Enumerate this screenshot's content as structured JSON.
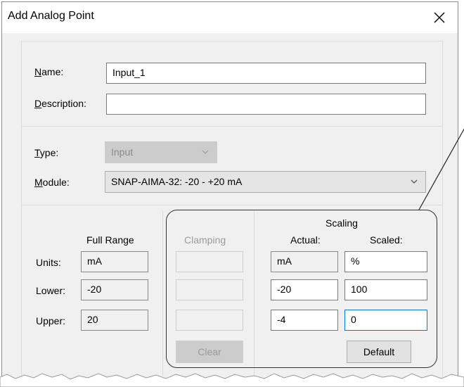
{
  "dialog": {
    "title": "Add Analog Point",
    "close_icon": "close-icon"
  },
  "general": {
    "name": {
      "label_accel": "N",
      "label_rest": "ame:",
      "value": "Input_1"
    },
    "description": {
      "label_accel": "D",
      "label_rest": "escription:",
      "value": ""
    }
  },
  "point": {
    "type": {
      "label_accel": "T",
      "label_rest": "ype:",
      "value": "Input"
    },
    "module": {
      "label_accel": "M",
      "label_rest": "odule:",
      "value": "SNAP-AIMA-32: -20 - +20 mA"
    }
  },
  "ranges": {
    "full_range_heading": "Full Range",
    "clamping_heading": "Clamping",
    "scaling_heading": "Scaling",
    "actual_heading": "Actual:",
    "scaled_heading": "Scaled:",
    "rows": [
      {
        "label": "Units:",
        "full": "mA",
        "actual": "mA",
        "scaled": "%"
      },
      {
        "label": "Lower:",
        "full": "-20",
        "actual": "-20",
        "scaled": "100"
      },
      {
        "label": "Upper:",
        "full": "20",
        "actual": "-4",
        "scaled": "0"
      }
    ],
    "clear_button": "Clear",
    "default_button": "Default"
  }
}
